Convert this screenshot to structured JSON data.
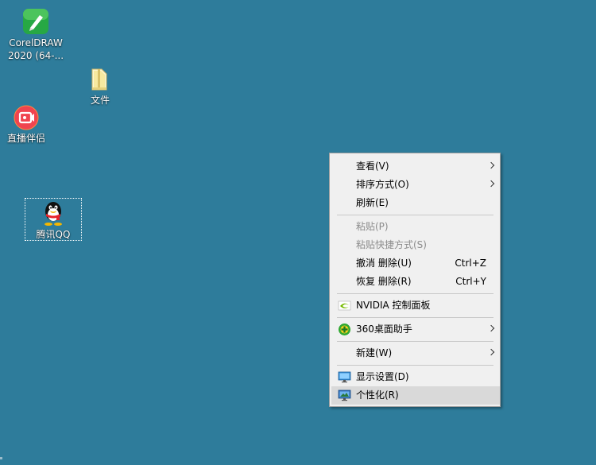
{
  "desktop": {
    "icons": [
      {
        "label_line1": "CorelDRAW",
        "label_line2": "2020 (64-...",
        "icon": "coreldraw-icon"
      },
      {
        "label": "文件",
        "icon": "folder-icon"
      },
      {
        "label": "直播伴侣",
        "icon": "live-companion-icon"
      },
      {
        "label": "腾讯QQ",
        "icon": "qq-penguin-icon"
      }
    ]
  },
  "context_menu": {
    "items": [
      {
        "label": "查看(V)",
        "submenu": true
      },
      {
        "label": "排序方式(O)",
        "submenu": true
      },
      {
        "label": "刷新(E)"
      },
      {
        "label": "粘贴(P)",
        "disabled": true
      },
      {
        "label": "粘贴快捷方式(S)",
        "disabled": true
      },
      {
        "label": "撤消 删除(U)",
        "shortcut": "Ctrl+Z"
      },
      {
        "label": "恢复 删除(R)",
        "shortcut": "Ctrl+Y"
      },
      {
        "label": "NVIDIA 控制面板",
        "icon": "nvidia-icon"
      },
      {
        "label": "360桌面助手",
        "icon": "360-icon",
        "submenu": true
      },
      {
        "label": "新建(W)",
        "submenu": true
      },
      {
        "label": "显示设置(D)",
        "icon": "display-settings-icon"
      },
      {
        "label": "个性化(R)",
        "icon": "personalize-icon",
        "highlighted": true
      }
    ]
  },
  "colors": {
    "desktop_background": "#2e7c9b",
    "menu_background": "#f0f0f0",
    "menu_highlight": "#d9d9d9",
    "disabled_text": "#8c8c8c"
  }
}
